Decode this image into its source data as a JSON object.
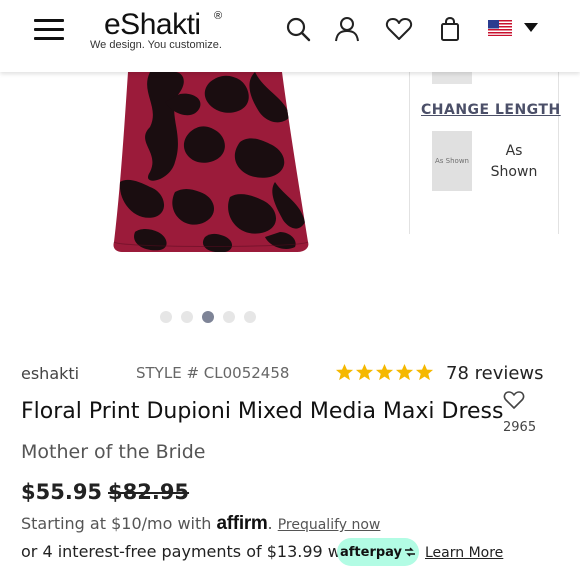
{
  "header": {
    "logo_name": "eShakti",
    "logo_tagline": "We design. You customize."
  },
  "gallery": {
    "dot_count": 5,
    "active_index": 2,
    "dress_colors": {
      "base": "#9b1b3a",
      "pattern": "#1a0d10"
    }
  },
  "options": {
    "change_length_label": "CHANGE LENGTH",
    "length_swatch_text": "As Shown",
    "length_option_label": "As Shown"
  },
  "product": {
    "brand": "eshakti",
    "style": "STYLE # CL0052458",
    "rating": 5,
    "reviews": "78 reviews",
    "title": "Floral Print Dupioni Mixed Media Maxi Dress",
    "favorite_count": "2965",
    "category": "Mother of the Bride",
    "price": "$55.95",
    "old_price": "$82.95"
  },
  "financing": {
    "affirm_prefix": "Starting at $10/mo with",
    "affirm_brand": "affirm",
    "prequalify_link": "Prequalify now",
    "afterpay_text": "or 4 interest-free payments of $13.99 with",
    "afterpay_brand": "afterpay",
    "learn_more": "Learn More"
  },
  "colors": {
    "accent_link": "#4b4f68",
    "star": "#f5b800",
    "afterpay_mint": "#b2fce4",
    "dot_active": "#7e8497"
  },
  "icons": [
    "hamburger-icon",
    "search-icon",
    "account-icon",
    "wishlist-icon",
    "bag-icon",
    "us-flag-icon",
    "chevron-down-icon",
    "star-icon",
    "heart-icon"
  ]
}
